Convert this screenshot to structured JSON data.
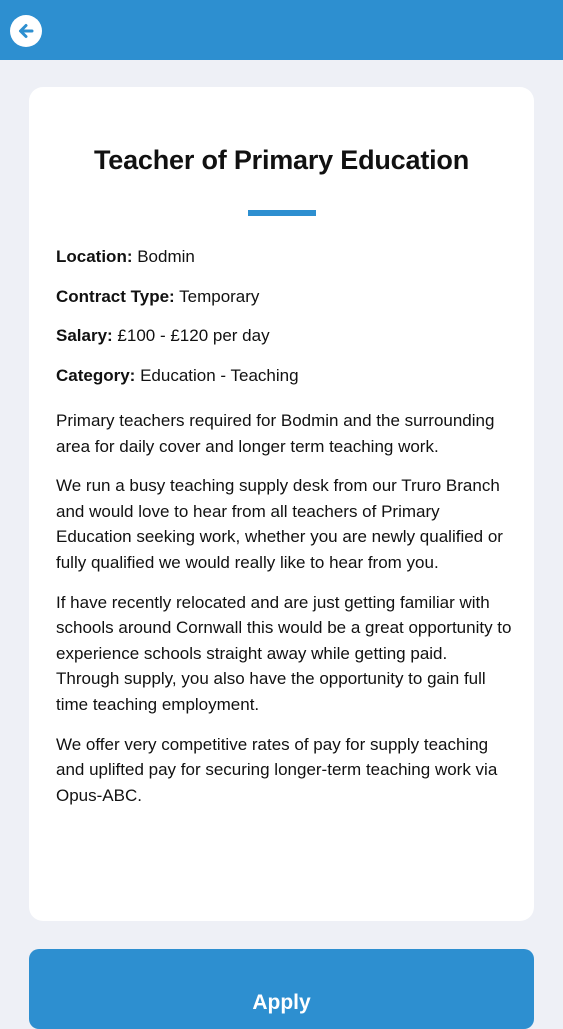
{
  "header": {
    "back_icon": "arrow-left-circle-icon",
    "background_color": "#2d8fd0"
  },
  "job": {
    "title": "Teacher of Primary Education",
    "details": [
      {
        "label": "Location:",
        "value": " Bodmin"
      },
      {
        "label": "Contract Type:",
        "value": " Temporary"
      },
      {
        "label": "Salary:",
        "value": " £100 - £120 per day"
      },
      {
        "label": "Category:",
        "value": " Education - Teaching"
      }
    ],
    "description": [
      "Primary teachers required for Bodmin and the surrounding area for daily cover and longer term teaching work.",
      "We run a busy teaching supply desk from our Truro Branch and would love to hear from all teachers of Primary Education seeking work, whether you are newly qualified or fully qualified we would really like to hear from you.",
      "If have recently relocated and are just getting familiar with schools around Cornwall this would be a great opportunity to experience schools straight away while getting paid. Through supply, you also have the opportunity to gain full time teaching employment.",
      "We offer very competitive rates of pay for supply teaching and uplifted pay for securing longer-term teaching work via Opus-ABC."
    ]
  },
  "actions": {
    "apply_label": "Apply"
  },
  "colors": {
    "accent": "#2d8fd0",
    "page_background": "#eef0f6",
    "card_background": "#ffffff"
  }
}
